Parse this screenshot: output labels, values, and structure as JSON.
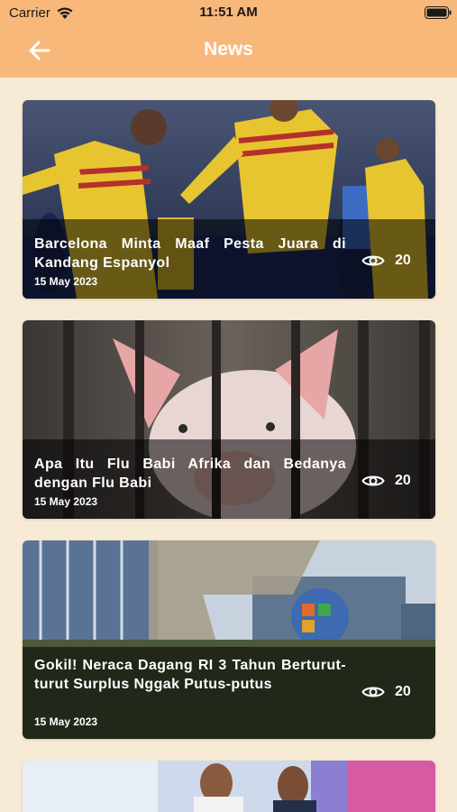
{
  "status_bar": {
    "carrier": "Carrier",
    "time": "11:51 AM"
  },
  "header": {
    "title": "News",
    "back_icon": "arrow-left-icon"
  },
  "colors": {
    "header_bg": "#f8b87a",
    "page_bg": "#f7ebd6",
    "text_on_header": "#ffffff"
  },
  "articles": [
    {
      "title": "Barcelona Minta Maaf Pesta Juara di Kandang Espanyol",
      "date": "15 May 2023",
      "views": "20",
      "image": "football-celebration-photo"
    },
    {
      "title": "Apa Itu Flu Babi Afrika dan Bedanya dengan Flu Babi",
      "date": "15 May 2023",
      "views": "20",
      "image": "pig-behind-bars-photo"
    },
    {
      "title": "Gokil! Neraca Dagang RI 3 Tahun Berturut-turut Surplus Nggak Putus-putus",
      "date": "15 May 2023",
      "views": "20",
      "image": "bps-building-photo"
    },
    {
      "title": "",
      "date": "",
      "views": "",
      "image": "officials-photo"
    }
  ]
}
